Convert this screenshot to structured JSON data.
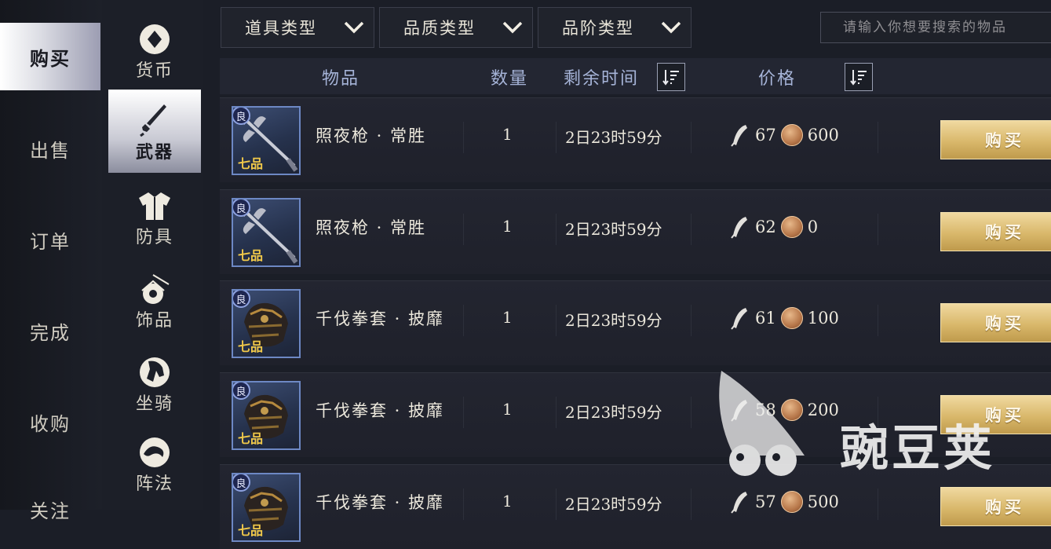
{
  "left_nav": [
    {
      "label": "购买",
      "active": true
    },
    {
      "label": "出售",
      "active": false
    },
    {
      "label": "订单",
      "active": false
    },
    {
      "label": "完成",
      "active": false
    },
    {
      "label": "收购",
      "active": false
    },
    {
      "label": "关注",
      "active": false
    }
  ],
  "categories": [
    {
      "label": "货币",
      "icon": "currency-icon",
      "active": false
    },
    {
      "label": "武器",
      "icon": "weapon-icon",
      "active": true
    },
    {
      "label": "防具",
      "icon": "armor-icon",
      "active": false
    },
    {
      "label": "饰品",
      "icon": "accessory-icon",
      "active": false
    },
    {
      "label": "坐骑",
      "icon": "mount-icon",
      "active": false
    },
    {
      "label": "阵法",
      "icon": "formation-icon",
      "active": false
    }
  ],
  "filters": [
    {
      "label": "道具类型"
    },
    {
      "label": "品质类型"
    },
    {
      "label": "品阶类型"
    }
  ],
  "search": {
    "placeholder": "请输入你想要搜索的物品"
  },
  "table": {
    "headers": {
      "item": "物品",
      "qty": "数量",
      "time": "剩余时间",
      "price": "价格"
    },
    "rows": [
      {
        "badge": "良",
        "grade": "七品",
        "name": "照夜枪 · 常胜",
        "qty": "1",
        "time": "2日23时59分",
        "price1": "67",
        "price2": "600",
        "buy": "购买",
        "icon": "spear-icon"
      },
      {
        "badge": "良",
        "grade": "七品",
        "name": "照夜枪 · 常胜",
        "qty": "1",
        "time": "2日23时59分",
        "price1": "62",
        "price2": "0",
        "buy": "购买",
        "icon": "spear-icon"
      },
      {
        "badge": "良",
        "grade": "七品",
        "name": "千伐拳套 · 披靡",
        "qty": "1",
        "time": "2日23时59分",
        "price1": "61",
        "price2": "100",
        "buy": "购买",
        "icon": "gauntlet-icon"
      },
      {
        "badge": "良",
        "grade": "七品",
        "name": "千伐拳套 · 披靡",
        "qty": "1",
        "time": "2日23时59分",
        "price1": "58",
        "price2": "200",
        "buy": "购买",
        "icon": "gauntlet-icon"
      },
      {
        "badge": "良",
        "grade": "七品",
        "name": "千伐拳套 · 披靡",
        "qty": "1",
        "time": "2日23时59分",
        "price1": "57",
        "price2": "500",
        "buy": "购买",
        "icon": "gauntlet-icon"
      }
    ]
  },
  "watermark": {
    "text": "豌豆荚"
  },
  "colors": {
    "buy_button": "#d9b86b",
    "active_nav": "#dcdde4",
    "quality_border": "#6d88c4",
    "grade_text": "#f1c94a"
  }
}
